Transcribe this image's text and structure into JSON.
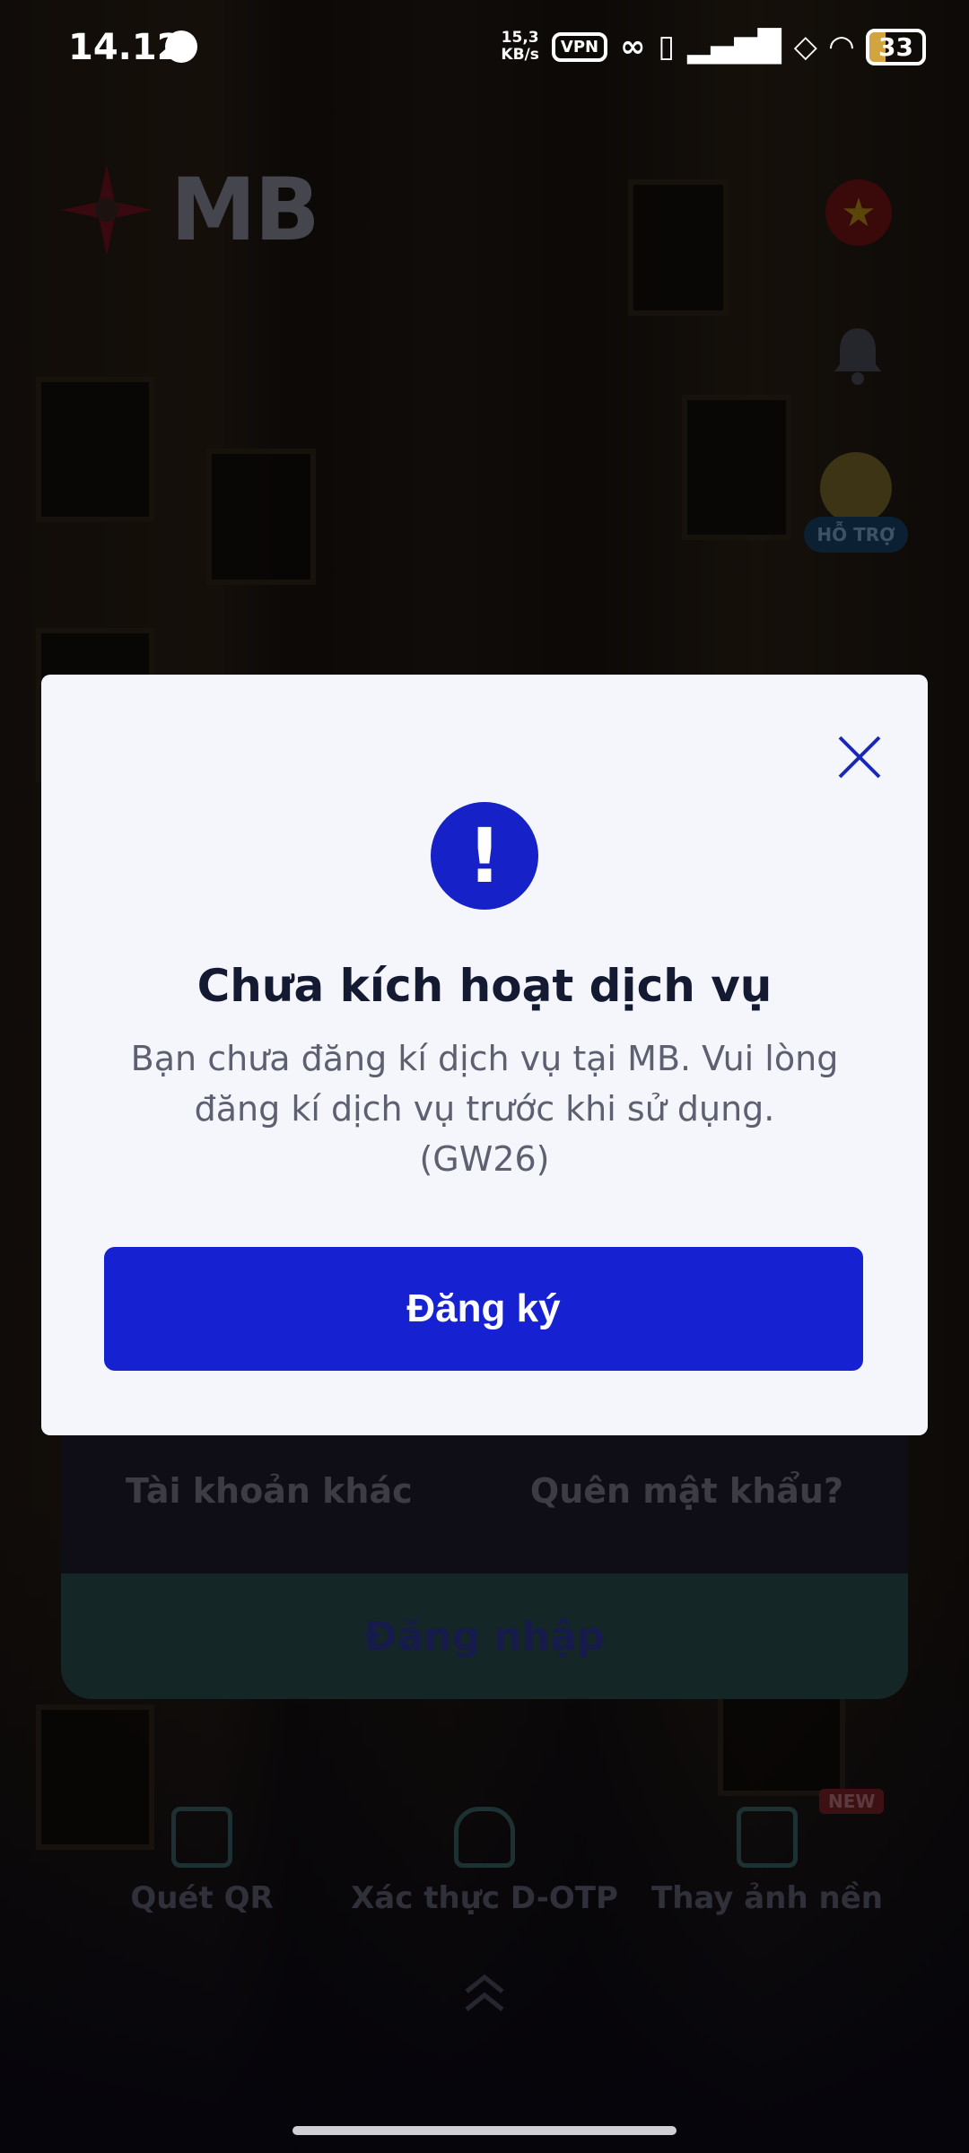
{
  "status_bar": {
    "time": "14.12",
    "speed_value": "15,3",
    "speed_unit": "KB/s",
    "vpn": "VPN",
    "battery": "33"
  },
  "background_app": {
    "brand": "MB",
    "support_label": "HỖ TRỢ",
    "other_account": "Tài khoản khác",
    "forgot_password": "Quên mật khẩu?",
    "login_button": "Đăng nhập",
    "quick_actions": [
      {
        "label": "Quét QR"
      },
      {
        "label": "Xác thực D-OTP"
      },
      {
        "label": "Thay ảnh nền",
        "badge": "NEW"
      }
    ]
  },
  "dialog": {
    "title": "Chưa kích hoạt dịch vụ",
    "message_line1": "Bạn chưa đăng kí dịch vụ tại MB. Vui lòng",
    "message_line2": "đăng kí dịch vụ trước khi sử dụng.",
    "message_line3": "(GW26)",
    "primary_button": "Đăng ký"
  },
  "colors": {
    "primary": "#1621d2",
    "dialog_bg": "#f4f6fb",
    "title": "#151a33"
  }
}
